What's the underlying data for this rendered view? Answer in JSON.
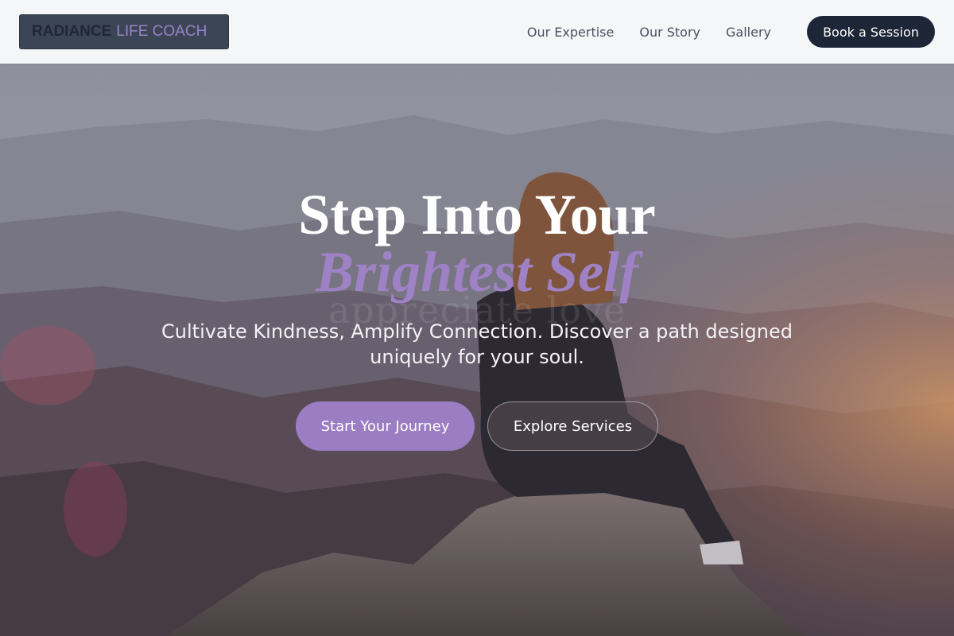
{
  "header": {
    "logo": {
      "strong": "RADIANCE",
      "light": "LIFE COACH"
    },
    "nav": [
      {
        "label": "Our Expertise"
      },
      {
        "label": "Our Story"
      },
      {
        "label": "Gallery"
      }
    ],
    "cta_label": "Book a Session"
  },
  "hero": {
    "background_image": "person-sitting-on-mountain-rock-at-sunrise",
    "watermark": "appreciate love",
    "headline_line1": "Step Into Your",
    "headline_line2": "Brightest Self",
    "subtext": "Cultivate Kindness, Amplify Connection. Discover a path designed uniquely for your soul.",
    "primary_button": "Start Your Journey",
    "secondary_button": "Explore Services"
  },
  "colors": {
    "brand_dark": "#1d2636",
    "accent_purple": "#9b7dc3",
    "headline_purple": "#9f82c6",
    "header_bg": "#f5f6f8"
  }
}
